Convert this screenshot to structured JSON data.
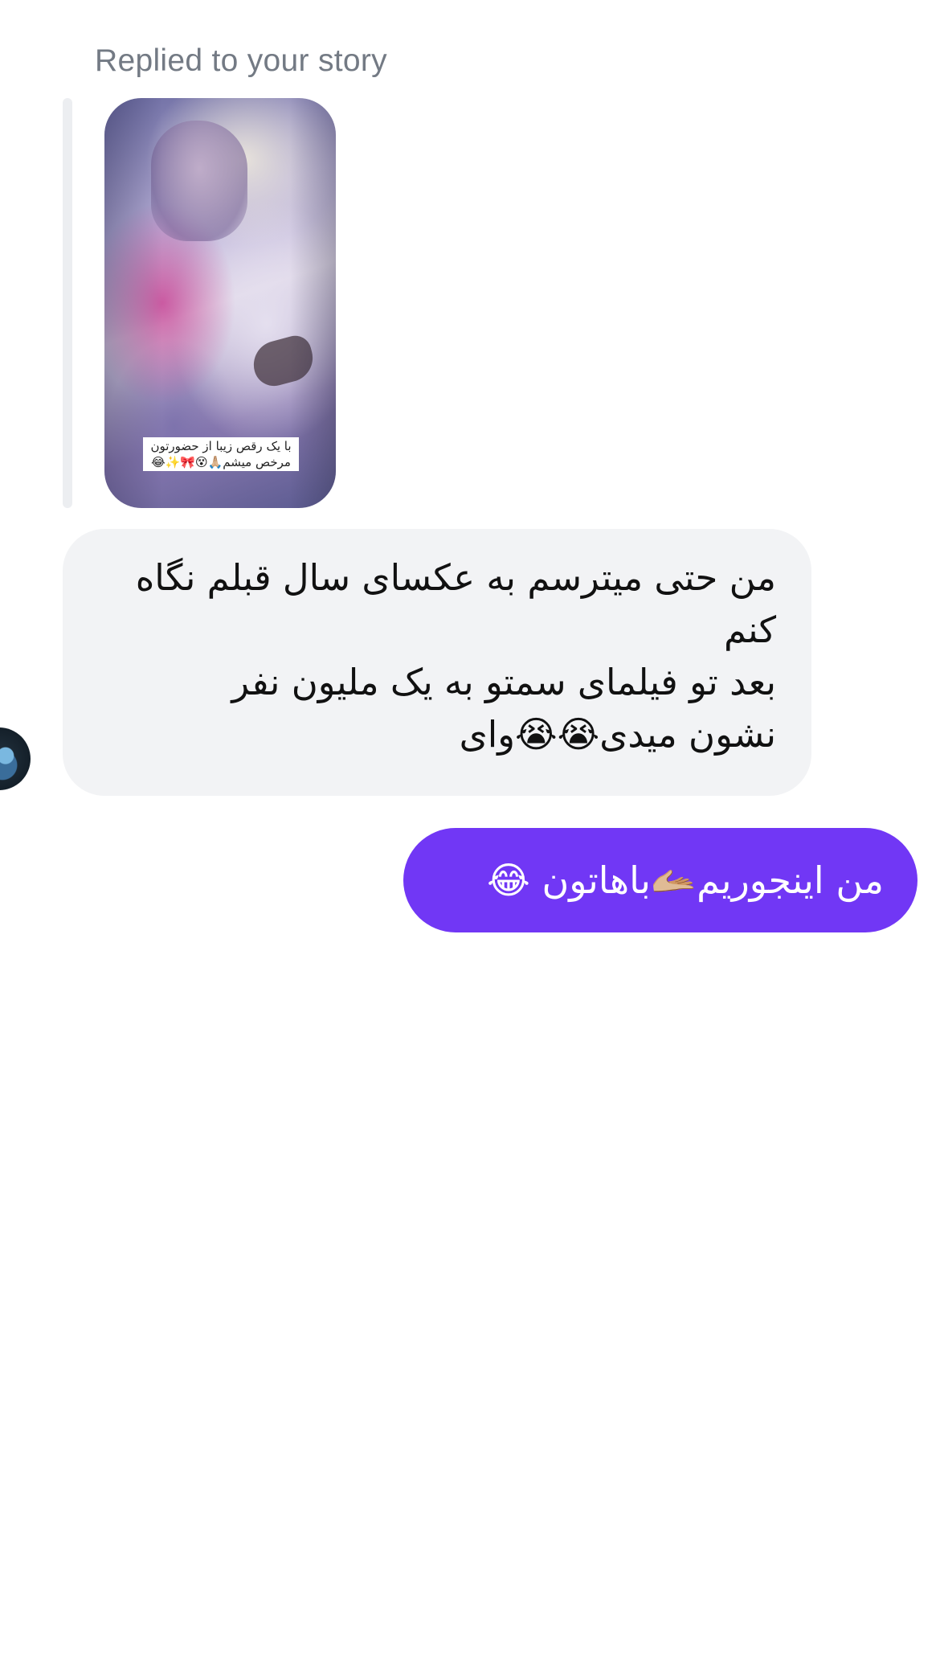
{
  "story_reply": {
    "caption": "Replied to your story",
    "thumbnail": {
      "overlay_text_line1": "با یک رقص زیبا از حضورتون",
      "overlay_text_line2": "مرخص میشم🙏🏼😵🎀✨😂"
    }
  },
  "messages": [
    {
      "direction": "incoming",
      "lines": [
        "من حتی میترسم به عکسای سال قبلم نگاه",
        "کنم",
        "بعد تو فیلمای سمتو به یک ملیون نفر",
        "نشون میدی😭😭وای"
      ]
    },
    {
      "direction": "outgoing",
      "text": "من اینجوریم🫴🏼باهاتون 😂",
      "bubble_color": "#7137f5"
    }
  ],
  "colors": {
    "incoming_bubble": "#f2f3f5",
    "caption_text": "#737a84",
    "outgoing_bubble": "#7137f5"
  }
}
